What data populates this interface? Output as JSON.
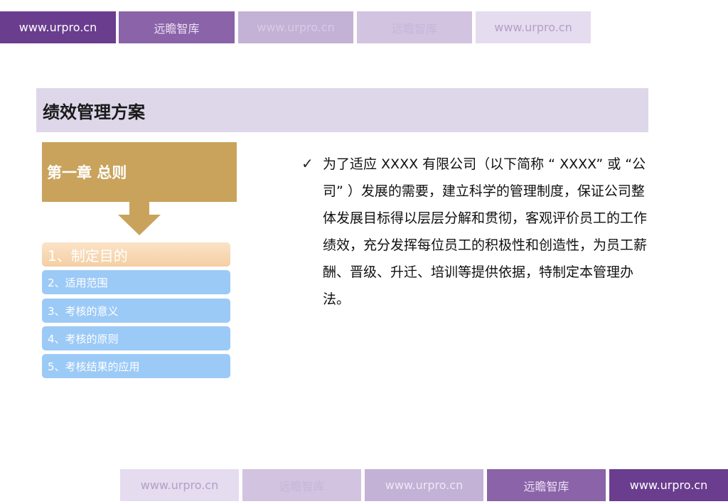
{
  "watermark": {
    "top": [
      "www.urpro.cn",
      "远瞻智库",
      "www.urpro.cn",
      "远瞻智库",
      "www.urpro.cn"
    ],
    "bottom": [
      "www.urpro.cn",
      "远瞻智库",
      "www.urpro.cn",
      "远瞻智库",
      "www.urpro.cn"
    ]
  },
  "page": {
    "title": "绩效管理方案"
  },
  "chapter": {
    "title": "第一章 总则"
  },
  "nav": {
    "items": [
      {
        "label": "1、制定目的"
      },
      {
        "label": "2、适用范围"
      },
      {
        "label": "3、考核的意义"
      },
      {
        "label": "4、考核的原则"
      },
      {
        "label": "5、考核结果的应用"
      }
    ]
  },
  "content": {
    "check_glyph": "✓",
    "text": "为了适应 XXXX 有限公司（以下简称 “ XXXX” 或 “公司” ）发展的需要，建立科学的管理制度，保证公司整体发展目标得以层层分解和贯彻，客观评价员工的工作绩效，充分发挥每位员工的积极性和创造性，为员工薪酬、晋级、升迁、培训等提供依据，特制定本管理办法。"
  },
  "colors": {
    "chapter_bg": "#c9a35c",
    "title_bar_bg": "#ded7e9",
    "nav_blue": "#9ccaf7",
    "nav_active": "#f4cfa4",
    "watermark_dark": "#6a3d8e"
  }
}
